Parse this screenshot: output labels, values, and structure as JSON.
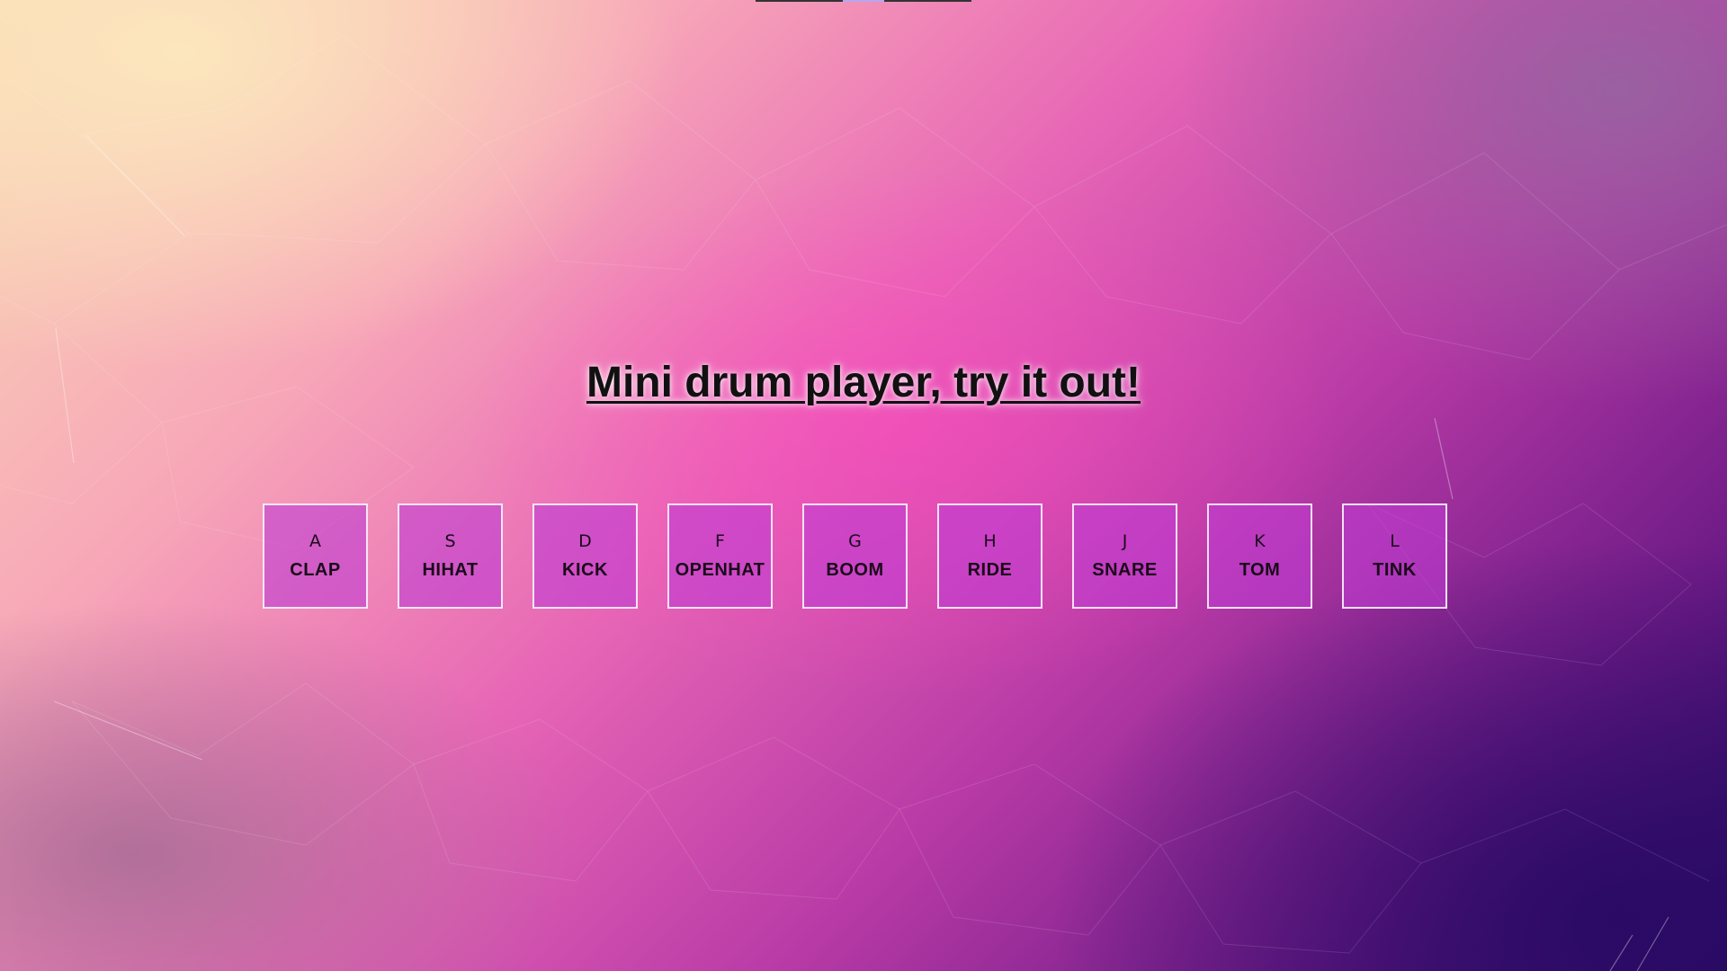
{
  "page": {
    "title": "Mini drum player, try it out!"
  },
  "keys": [
    {
      "letter": "A",
      "sound": "CLAP"
    },
    {
      "letter": "S",
      "sound": "HIHAT"
    },
    {
      "letter": "D",
      "sound": "KICK"
    },
    {
      "letter": "F",
      "sound": "OPENHAT"
    },
    {
      "letter": "G",
      "sound": "BOOM"
    },
    {
      "letter": "H",
      "sound": "RIDE"
    },
    {
      "letter": "J",
      "sound": "SNARE"
    },
    {
      "letter": "K",
      "sound": "TOM"
    },
    {
      "letter": "L",
      "sound": "TINK"
    }
  ],
  "colors": {
    "key_background": "#be3cd2",
    "key_border": "#ffffff",
    "title_text": "#111111"
  }
}
